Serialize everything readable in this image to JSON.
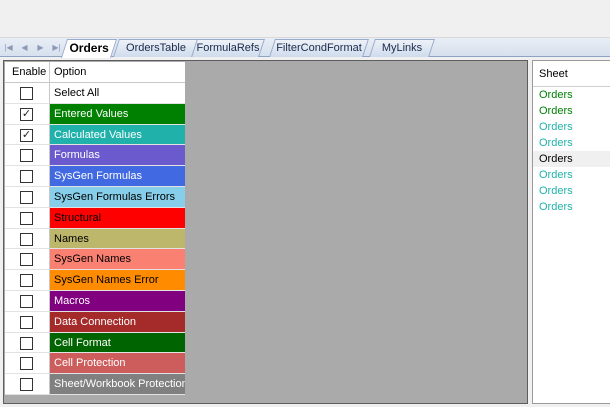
{
  "tabs": {
    "nav_glyphs": [
      "|◀",
      "◀",
      "▶",
      "▶|"
    ],
    "items": [
      {
        "label": "Orders",
        "active": true
      },
      {
        "label": "OrdersTable",
        "active": false
      },
      {
        "label": "FormulaRefs",
        "active": false
      },
      {
        "label": "FilterCondFormat",
        "active": false
      },
      {
        "label": "MyLinks",
        "active": false
      }
    ]
  },
  "options": {
    "headers": {
      "enable": "Enable",
      "option": "Option"
    },
    "rows": [
      {
        "label": "Select All",
        "checked": false,
        "bg": "#ffffff",
        "fg": "#000000"
      },
      {
        "label": "Entered Values",
        "checked": true,
        "bg": "#008000",
        "fg": "#ffffff"
      },
      {
        "label": "Calculated Values",
        "checked": true,
        "bg": "#20b2aa",
        "fg": "#ffffff"
      },
      {
        "label": "Formulas",
        "checked": false,
        "bg": "#6a5acd",
        "fg": "#ffffff"
      },
      {
        "label": "SysGen Formulas",
        "checked": false,
        "bg": "#4169e1",
        "fg": "#ffffff"
      },
      {
        "label": "SysGen Formulas Errors",
        "checked": false,
        "bg": "#87ceeb",
        "fg": "#000000"
      },
      {
        "label": "Structural",
        "checked": false,
        "bg": "#ff0000",
        "fg": "#000000"
      },
      {
        "label": "Names",
        "checked": false,
        "bg": "#bdb76b",
        "fg": "#000000"
      },
      {
        "label": "SysGen Names",
        "checked": false,
        "bg": "#fa8072",
        "fg": "#000000"
      },
      {
        "label": "SysGen Names Error",
        "checked": false,
        "bg": "#ff8c00",
        "fg": "#000000"
      },
      {
        "label": "Macros",
        "checked": false,
        "bg": "#800080",
        "fg": "#ffffff"
      },
      {
        "label": "Data Connection",
        "checked": false,
        "bg": "#a52a2a",
        "fg": "#ffffff"
      },
      {
        "label": "Cell Format",
        "checked": false,
        "bg": "#006400",
        "fg": "#ffffff"
      },
      {
        "label": "Cell Protection",
        "checked": false,
        "bg": "#cd5c5c",
        "fg": "#ffffff"
      },
      {
        "label": "Sheet/Workbook Protection",
        "checked": false,
        "bg": "#808080",
        "fg": "#ffffff"
      }
    ]
  },
  "sheets": {
    "header": "Sheet",
    "rows": [
      {
        "name": "Orders",
        "color": "#008000",
        "selected": false
      },
      {
        "name": "Orders",
        "color": "#008000",
        "selected": false
      },
      {
        "name": "Orders",
        "color": "#20b2aa",
        "selected": false
      },
      {
        "name": "Orders",
        "color": "#20b2aa",
        "selected": false
      },
      {
        "name": "Orders",
        "color": "#000000",
        "selected": true
      },
      {
        "name": "Orders",
        "color": "#20b2aa",
        "selected": false
      },
      {
        "name": "Orders",
        "color": "#20b2aa",
        "selected": false
      },
      {
        "name": "Orders",
        "color": "#20b2aa",
        "selected": false
      }
    ]
  }
}
